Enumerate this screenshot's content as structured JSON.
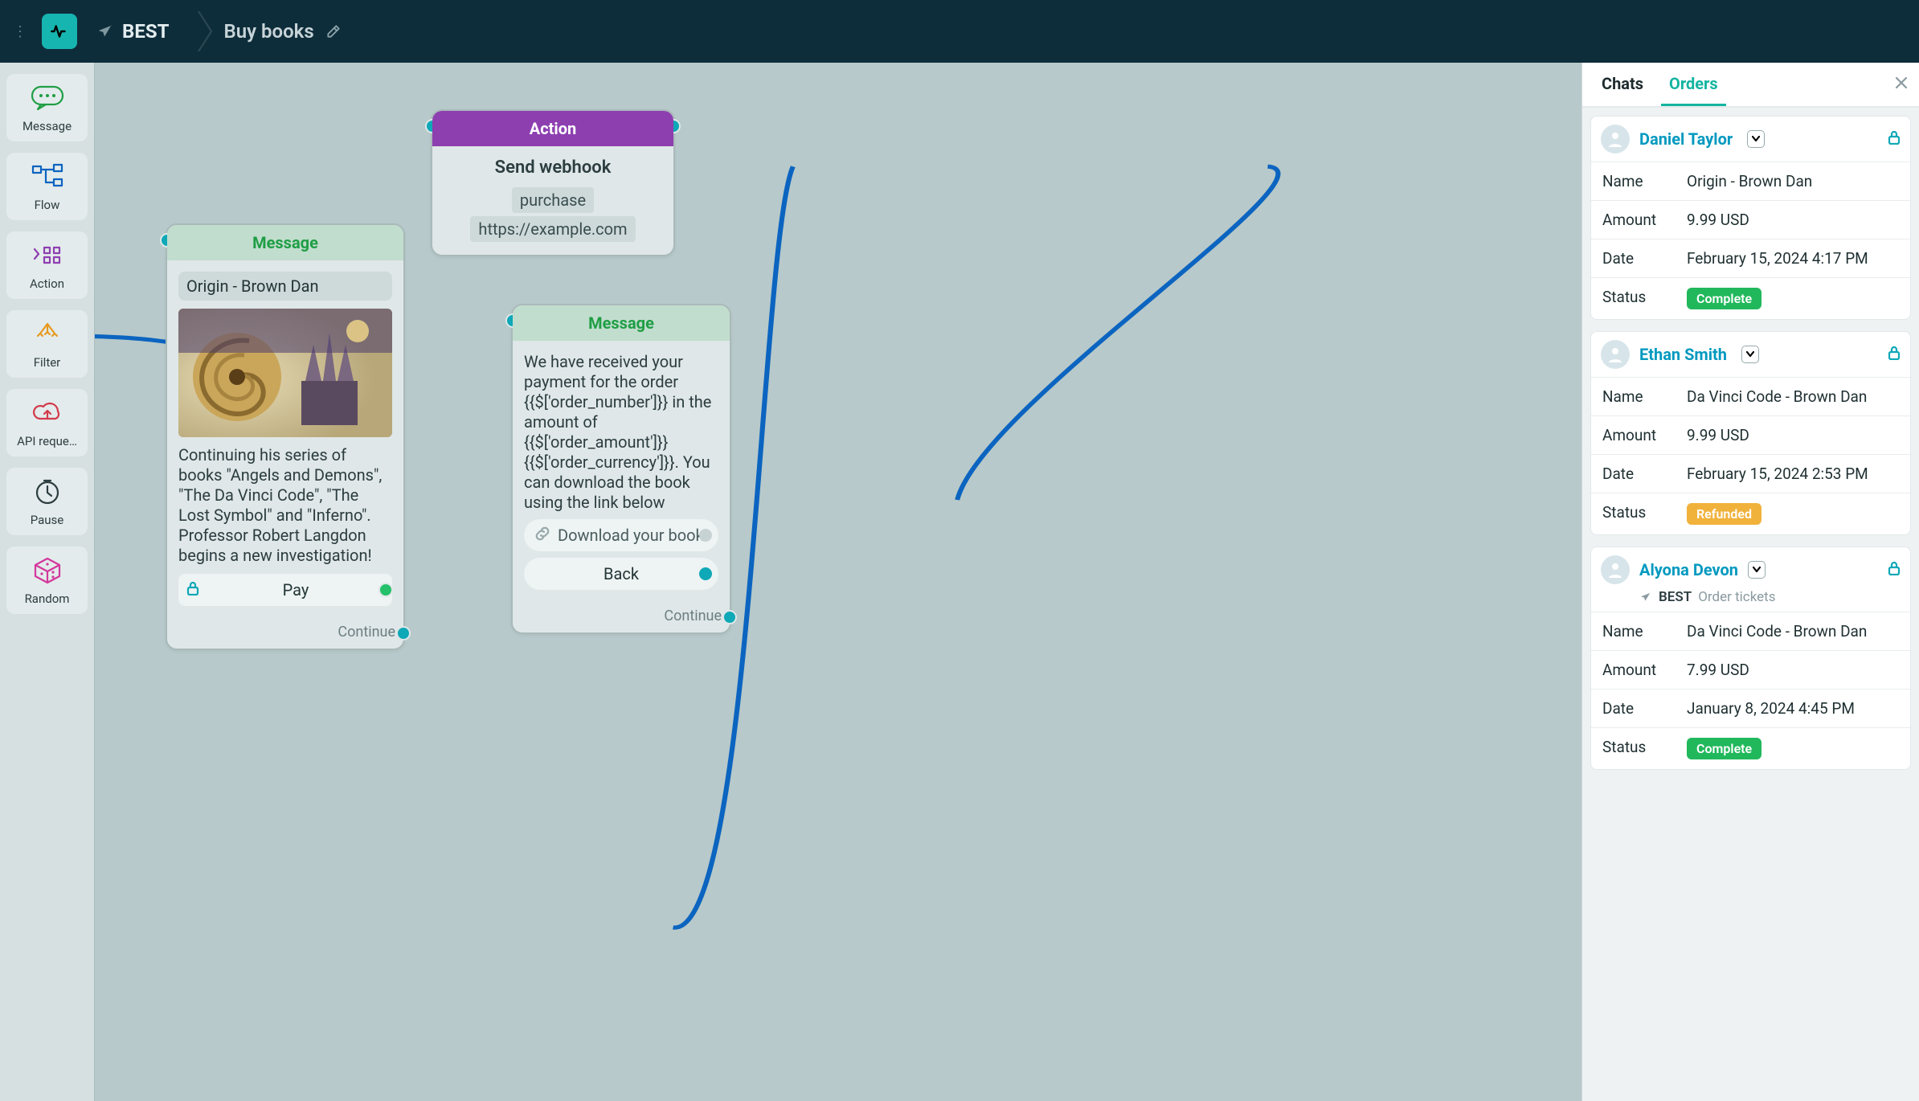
{
  "topbar": {
    "workspace": "BEST",
    "title": "Buy books"
  },
  "toolrail": [
    {
      "id": "message",
      "label": "Message",
      "icon": "chat-icon",
      "color": "#1f9e45"
    },
    {
      "id": "flow",
      "label": "Flow",
      "icon": "flow-icon",
      "color": "#0b64c0"
    },
    {
      "id": "action",
      "label": "Action",
      "icon": "action-icon",
      "color": "#8d3fb0"
    },
    {
      "id": "filter",
      "label": "Filter",
      "icon": "filter-icon",
      "color": "#e69a1f"
    },
    {
      "id": "api",
      "label": "API reque…",
      "icon": "cloud-icon",
      "color": "#d23b4b"
    },
    {
      "id": "pause",
      "label": "Pause",
      "icon": "clock-icon",
      "color": "#2c3d40"
    },
    {
      "id": "random",
      "label": "Random",
      "icon": "dice-icon",
      "color": "#d3379b"
    }
  ],
  "nodes": {
    "msg1": {
      "header": "Message",
      "title": "Origin - Brown Dan",
      "body": "Continuing his series of books \"Angels and Demons\", \"The Da Vinci Code\", \"The Lost Symbol\" and \"Inferno\". Professor Robert Langdon begins a new investigation!",
      "payLabel": "Pay",
      "continue": "Continue"
    },
    "action1": {
      "header": "Action",
      "title": "Send webhook",
      "event": "purchase",
      "url": "https://example.com"
    },
    "msg2": {
      "header": "Message",
      "body": "We have received your payment for the order {{$['order_number']}} in the amount of {{$['order_amount']}} {{$['order_currency']}}. You can download the book using the link below",
      "btnDownload": "Download your book",
      "btnBack": "Back",
      "continue": "Continue"
    }
  },
  "rightPanel": {
    "tabs": {
      "chats": "Chats",
      "orders": "Orders"
    },
    "rowLabels": {
      "name": "Name",
      "amount": "Amount",
      "date": "Date",
      "status": "Status"
    },
    "orders": [
      {
        "customer": "Daniel Taylor",
        "name": "Origin - Brown Dan",
        "amount": "9.99 USD",
        "date": "February 15, 2024 4:17 PM",
        "status": "Complete",
        "statusKind": "green"
      },
      {
        "customer": "Ethan Smith",
        "name": "Da Vinci Code - Brown Dan",
        "amount": "9.99 USD",
        "date": "February 15, 2024 2:53 PM",
        "status": "Refunded",
        "statusKind": "orange"
      },
      {
        "customer": "Alyona Devon",
        "sourceBest": "BEST",
        "sourceFlow": "Order tickets",
        "name": "Da Vinci Code - Brown Dan",
        "amount": "7.99 USD",
        "date": "January 8, 2024 4:45 PM",
        "status": "Complete",
        "statusKind": "green"
      }
    ]
  }
}
